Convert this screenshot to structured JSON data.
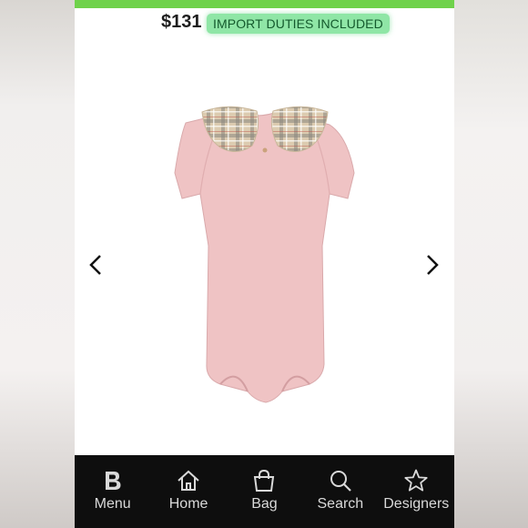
{
  "product": {
    "price": "$131",
    "duty_badge": "IMPORT DUTIES INCLUDED",
    "image_name": "pink-bodysuit-with-check-collar"
  },
  "loading_progress": 1.0,
  "colors": {
    "progress": "#6fd24b",
    "badge_bg": "#8fe6a6",
    "badge_text": "#145a2d",
    "nav_bg": "#0e0e0e",
    "nav_text": "#d9d9d9",
    "bodysuit": "#efc3c4"
  },
  "icons": {
    "prev": "chevron-left-icon",
    "next": "chevron-right-icon"
  },
  "bottom_nav": {
    "items": [
      {
        "label": "Menu",
        "icon": "brand-b-icon"
      },
      {
        "label": "Home",
        "icon": "house-icon"
      },
      {
        "label": "Bag",
        "icon": "shopping-bag-icon"
      },
      {
        "label": "Search",
        "icon": "search-icon"
      },
      {
        "label": "Designers",
        "icon": "star-icon"
      }
    ]
  }
}
